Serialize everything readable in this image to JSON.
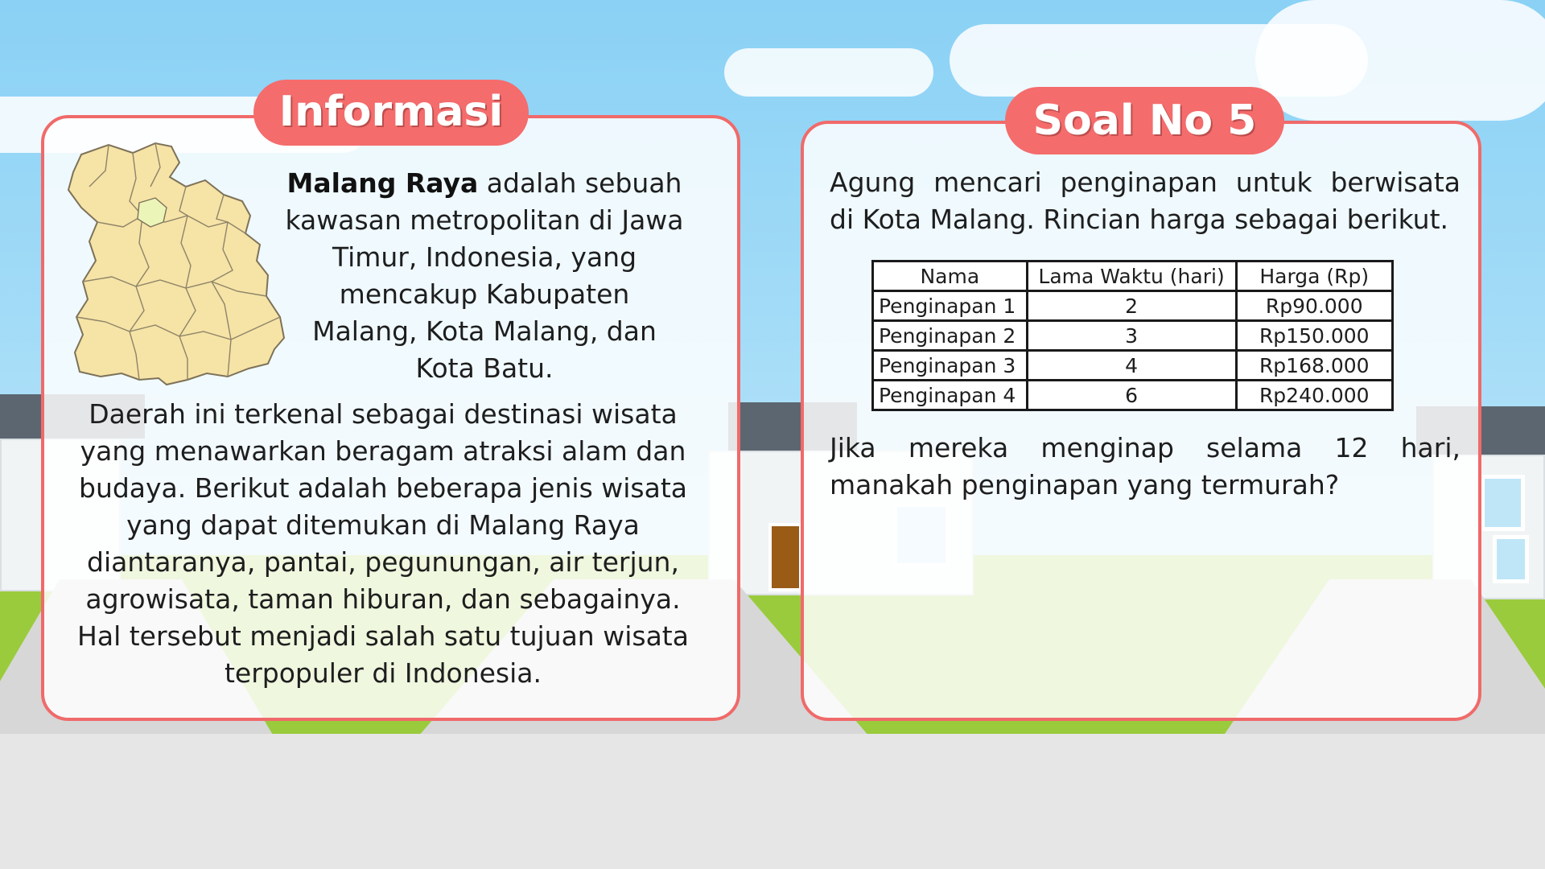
{
  "info_card": {
    "title": "Informasi",
    "intro_bold": "Malang Raya",
    "intro_rest": " adalah sebuah kawasan metropolitan di Jawa Timur, Indonesia, yang mencakup Kabupaten Malang, Kota Malang, dan Kota Batu.",
    "body": "Daerah ini terkenal sebagai destinasi wisata yang menawarkan beragam atraksi alam dan budaya. Berikut adalah beberapa jenis wisata yang dapat ditemukan di Malang Raya diantaranya, pantai, pegunungan, air terjun, agrowisata, taman hiburan, dan sebagainya. Hal tersebut menjadi salah satu tujuan wisata terpopuler di Indonesia.",
    "map_icon": "malang-raya-map-icon"
  },
  "question_card": {
    "title": "Soal No 5",
    "intro_line1": "Agung mencari penginapan untuk berwisata",
    "intro_line2": "di Kota Malang. Rincian harga sebagai berikut.",
    "table": {
      "headers": [
        "Nama",
        "Lama Waktu (hari)",
        "Harga (Rp)"
      ],
      "rows": [
        [
          "Penginapan 1",
          "2",
          "Rp90.000"
        ],
        [
          "Penginapan 2",
          "3",
          "Rp150.000"
        ],
        [
          "Penginapan 3",
          "4",
          "Rp168.000"
        ],
        [
          "Penginapan 4",
          "6",
          "Rp240.000"
        ]
      ]
    },
    "question": "Jika mereka menginap selama 12 hari, manakah penginapan yang termurah?"
  },
  "colors": {
    "accent": "#f46c6c",
    "card_border": "#f06a6a",
    "sky": "#8ad1f5",
    "grass": "#9acb3c",
    "road": "#e6e6e6"
  }
}
